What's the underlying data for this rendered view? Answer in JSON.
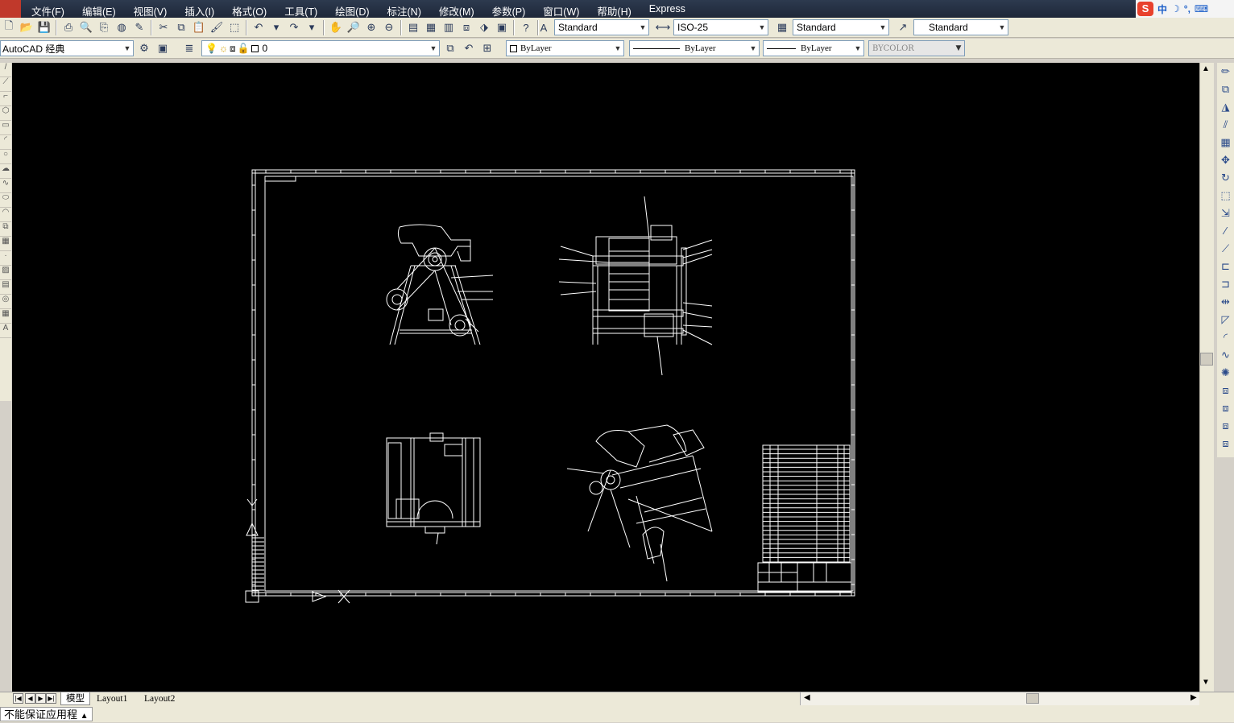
{
  "menubar": {
    "items": [
      "文件(F)",
      "编辑(E)",
      "视图(V)",
      "插入(I)",
      "格式(O)",
      "工具(T)",
      "绘图(D)",
      "标注(N)",
      "修改(M)",
      "参数(P)",
      "窗口(W)",
      "帮助(H)",
      "Express"
    ]
  },
  "ime": {
    "lang": "中"
  },
  "styles_toolbar": {
    "text_style": "Standard",
    "dim_style": "ISO-25",
    "table_style": "Standard",
    "multileader_style": "Standard"
  },
  "workspace": {
    "name": "AutoCAD 经典"
  },
  "layer": {
    "current": "0"
  },
  "properties": {
    "color": "ByLayer",
    "linetype": "ByLayer",
    "lineweight": "ByLayer",
    "plotstyle": "BYCOLOR"
  },
  "tabs": {
    "model": "模型",
    "layout1": "Layout1",
    "layout2": "Layout2"
  },
  "status": {
    "warning": "不能保证应用程"
  },
  "colors": {
    "canvas": "#000000",
    "linework": "#ffffff",
    "chrome": "#ece9d8",
    "menubar": "#1e2738"
  }
}
